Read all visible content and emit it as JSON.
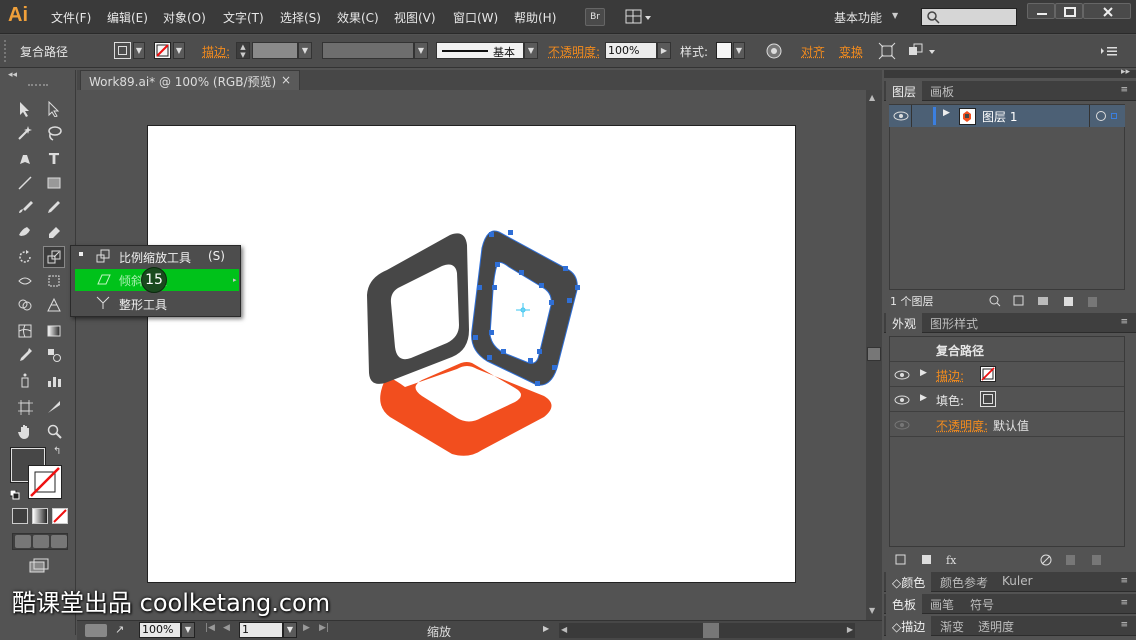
{
  "app": {
    "logo": "Ai",
    "workspace": "基本功能"
  },
  "menu": [
    "文件(F)",
    "编辑(E)",
    "对象(O)",
    "文字(T)",
    "选择(S)",
    "效果(C)",
    "视图(V)",
    "窗口(W)",
    "帮助(H)"
  ],
  "menubar_buttons": {
    "bridge": "Br"
  },
  "control": {
    "selection": "复合路径",
    "stroke_label": "描边:",
    "brush_label": "基本",
    "opacity_label": "不透明度:",
    "opacity_value": "100%",
    "style_label": "样式:",
    "align_label": "对齐",
    "transform_label": "变换"
  },
  "document": {
    "tab_title": "Work89.ai* @ 100% (RGB/预览)",
    "close": "×"
  },
  "flyout": {
    "items": [
      {
        "label": "比例缩放工具",
        "shortcut": "(S)"
      },
      {
        "label": "倾斜工具",
        "badge": "15"
      },
      {
        "label": "整形工具"
      }
    ]
  },
  "layers_panel": {
    "tabs": [
      "图层",
      "画板"
    ],
    "layer_name": "图层 1",
    "count": "1 个图层"
  },
  "appearance_panel": {
    "tabs": [
      "外观",
      "图形样式"
    ],
    "title": "复合路径",
    "rows": [
      {
        "label": "描边:"
      },
      {
        "label": "填色:"
      },
      {
        "label": "不透明度:",
        "value": "默认值"
      }
    ]
  },
  "collapsed_panels": [
    [
      "颜色",
      "颜色参考",
      "Kuler"
    ],
    [
      "色板",
      "画笔",
      "符号"
    ],
    [
      "描边",
      "渐变",
      "透明度"
    ]
  ],
  "status": {
    "zoom": "100%",
    "page": "1",
    "tool": "缩放"
  },
  "watermark": "酷课堂出品 coolketang.com",
  "colors": {
    "orange": "#f24e1e",
    "dark": "#474747",
    "selection": "#2f6fd6",
    "highlight": "#00c21a"
  }
}
